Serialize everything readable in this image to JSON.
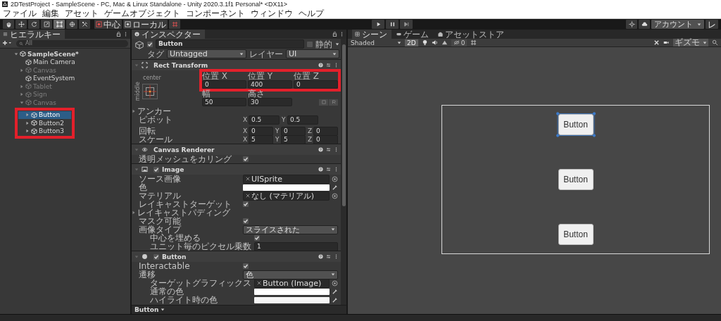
{
  "window": {
    "title": "2DTestProject - SampleScene - PC, Mac & Linux Standalone - Unity 2020.3.1f1 Personal* <DX11>"
  },
  "menu": [
    "ファイル",
    "編集",
    "アセット",
    "ゲームオブジェクト",
    "コンポーネント",
    "ウィンドウ",
    "ヘルプ"
  ],
  "toolbar": {
    "tools": [
      {
        "kind": "hand",
        "selected": false
      },
      {
        "kind": "move",
        "selected": false
      },
      {
        "kind": "rotate",
        "selected": false
      },
      {
        "kind": "scale",
        "selected": false
      },
      {
        "kind": "rect",
        "selected": true
      },
      {
        "kind": "transform",
        "selected": false
      },
      {
        "kind": "custom",
        "selected": false
      }
    ],
    "pivot": [
      {
        "kind": "pivot",
        "label": "中心"
      },
      {
        "kind": "space",
        "label": "ローカル"
      }
    ],
    "account": "アカウント",
    "layers": "レ"
  },
  "hierarchy": {
    "tab": "ヒエラルキー",
    "search": {
      "placeholder": "All"
    },
    "tree": [
      {
        "name": "SampleScene*",
        "selected": false,
        "disabled": false,
        "expanded": true,
        "children": [
          {
            "name": "Main Camera",
            "selected": false,
            "disabled": false
          },
          {
            "name": "Canvas",
            "selected": false,
            "disabled": true,
            "expanded": false
          },
          {
            "name": "EventSystem",
            "selected": false,
            "disabled": false
          },
          {
            "name": "Tablet",
            "selected": false,
            "disabled": true,
            "expanded": false
          },
          {
            "name": "Sign",
            "selected": false,
            "disabled": true,
            "expanded": false
          },
          {
            "name": "Canvas",
            "selected": false,
            "disabled": true,
            "expanded": true,
            "highlighted": true,
            "children": [
              {
                "name": "Button",
                "selected": true,
                "disabled": false,
                "expanded": false
              },
              {
                "name": "Button2",
                "selected": false,
                "disabled": false,
                "expanded": false
              },
              {
                "name": "Button3",
                "selected": false,
                "disabled": false,
                "expanded": false
              }
            ]
          }
        ]
      }
    ]
  },
  "inspector": {
    "tab": "インスペクター",
    "object": {
      "active": true,
      "name": "Button",
      "static": false,
      "static_label": "静的",
      "tag_label": "タグ",
      "tag": "Untagged",
      "layer_label": "レイヤー",
      "layer": "UI"
    },
    "components": [
      {
        "kind": "rect_transform",
        "title": "Rect Transform",
        "expanded": true,
        "anchor_h": "center",
        "anchor_v": "middle",
        "highlighted": true,
        "position": [
          {
            "label": "位置 X",
            "value": "0"
          },
          {
            "label": "位置 Y",
            "value": "400"
          },
          {
            "label": "位置 Z",
            "value": "0"
          }
        ],
        "size": [
          {
            "label": "幅",
            "value": "50"
          },
          {
            "label": "高さ",
            "value": "30"
          }
        ],
        "rows": [
          {
            "label": "アンカー",
            "kind": "foldout",
            "expanded": false
          },
          {
            "label": "ピボット",
            "kind": "vector",
            "values": [
              {
                "axis": "X",
                "value": "0.5"
              },
              {
                "axis": "Y",
                "value": "0.5"
              }
            ]
          },
          {
            "label": "回転",
            "kind": "vector",
            "values": [
              {
                "axis": "X",
                "value": "0"
              },
              {
                "axis": "Y",
                "value": "0"
              },
              {
                "axis": "Z",
                "value": "0"
              }
            ]
          },
          {
            "label": "スケール",
            "kind": "vector",
            "values": [
              {
                "axis": "X",
                "value": "5"
              },
              {
                "axis": "Y",
                "value": "5"
              },
              {
                "axis": "Z",
                "value": "0"
              }
            ]
          }
        ]
      },
      {
        "kind": "canvas_renderer",
        "title": "Canvas Renderer",
        "expanded": true,
        "rows": [
          {
            "label": "透明メッシュをカリング",
            "kind": "checkbox",
            "checked": true
          }
        ]
      },
      {
        "kind": "image",
        "title": "Image",
        "enabled": true,
        "expanded": true,
        "rows": [
          {
            "label": "ソース画像",
            "kind": "object",
            "value": "UISprite"
          },
          {
            "label": "色",
            "kind": "color",
            "color": "#ffffff"
          },
          {
            "label": "マテリアル",
            "kind": "object",
            "value": "なし (マテリアル)"
          },
          {
            "label": "レイキャストターゲット",
            "kind": "checkbox",
            "checked": true
          },
          {
            "label": "レイキャストパディング",
            "kind": "foldout",
            "expanded": false
          },
          {
            "label": "マスク可能",
            "kind": "checkbox",
            "checked": true
          },
          {
            "label": "画像タイプ",
            "kind": "dropdown",
            "value": "スライスされた",
            "children": [
              {
                "label": "中心を埋める",
                "kind": "checkbox",
                "checked": true
              },
              {
                "label": "ユニット毎のピクセル乗数",
                "kind": "number",
                "value": "1"
              }
            ]
          }
        ]
      },
      {
        "kind": "button",
        "title": "Button",
        "enabled": true,
        "expanded": true,
        "rows": [
          {
            "label": "Interactable",
            "kind": "checkbox",
            "checked": true
          },
          {
            "label": "遷移",
            "kind": "dropdown",
            "value": "色",
            "children": [
              {
                "label": "ターゲットグラフィックス",
                "kind": "object",
                "value": "Button (Image)"
              },
              {
                "label": "通常の色",
                "kind": "color",
                "color": "#ffffff"
              },
              {
                "label": "ハイライト時の色",
                "kind": "color",
                "color": "#f5f5f5"
              }
            ]
          }
        ]
      }
    ],
    "footer": "Button"
  },
  "scene": {
    "tabs": [
      {
        "label": "シーン",
        "selected": true
      },
      {
        "label": "ゲーム",
        "selected": false
      },
      {
        "label": "アセットストア",
        "selected": false
      }
    ],
    "shading": "Shaded",
    "mode_2d": {
      "label": "2D",
      "on": true
    },
    "hidden_count": "0",
    "gizmos": "ギズモ",
    "buttons": [
      {
        "label": "Button",
        "selected": true
      },
      {
        "label": "Button",
        "selected": false
      },
      {
        "label": "Button",
        "selected": false
      }
    ]
  }
}
